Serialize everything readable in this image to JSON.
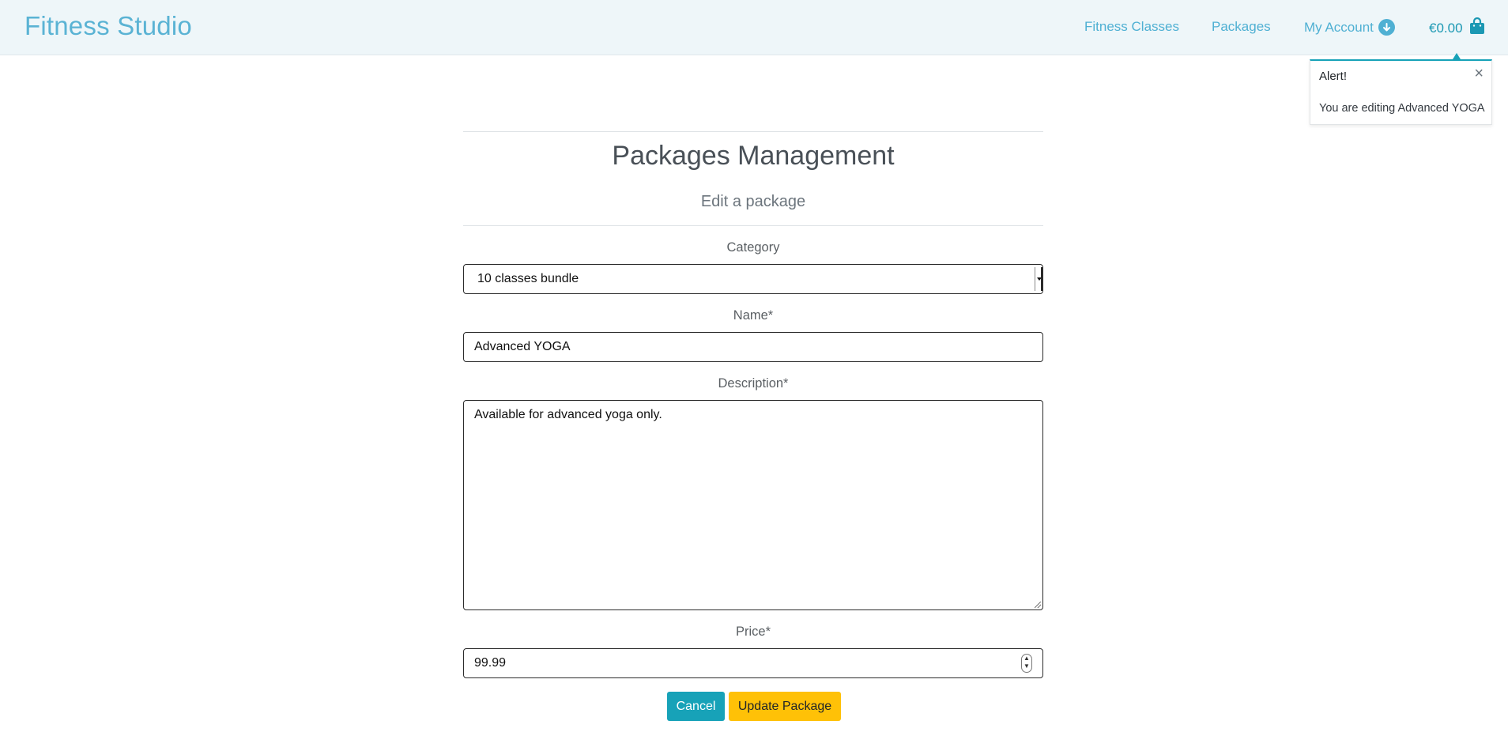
{
  "header": {
    "brand": "Fitness Studio",
    "nav": {
      "fitness_classes": "Fitness Classes",
      "packages": "Packages",
      "my_account": "My Account",
      "cart_total": "€0.00"
    },
    "icons": {
      "account": "arrow-circle-down-icon",
      "cart": "shopping-bag-icon"
    }
  },
  "toast": {
    "title": "Alert!",
    "close": "×",
    "message": "You are editing Advanced YOGA"
  },
  "main": {
    "title": "Packages Management",
    "subtitle": "Edit a package",
    "fields": {
      "category": {
        "label": "Category",
        "value": "10 classes bundle"
      },
      "name": {
        "label": "Name*",
        "value": "Advanced YOGA"
      },
      "description": {
        "label": "Description*",
        "value": "Available for advanced yoga only."
      },
      "price": {
        "label": "Price*",
        "value": "99.99"
      }
    },
    "buttons": {
      "cancel": "Cancel",
      "update": "Update Package"
    }
  },
  "colors": {
    "brand": "#5ab3d4",
    "nav_link": "#4fb0d3",
    "cart": "#1b98b3",
    "info": "#17a2b8",
    "warning": "#ffc107",
    "header_bg": "#eef6f9"
  }
}
